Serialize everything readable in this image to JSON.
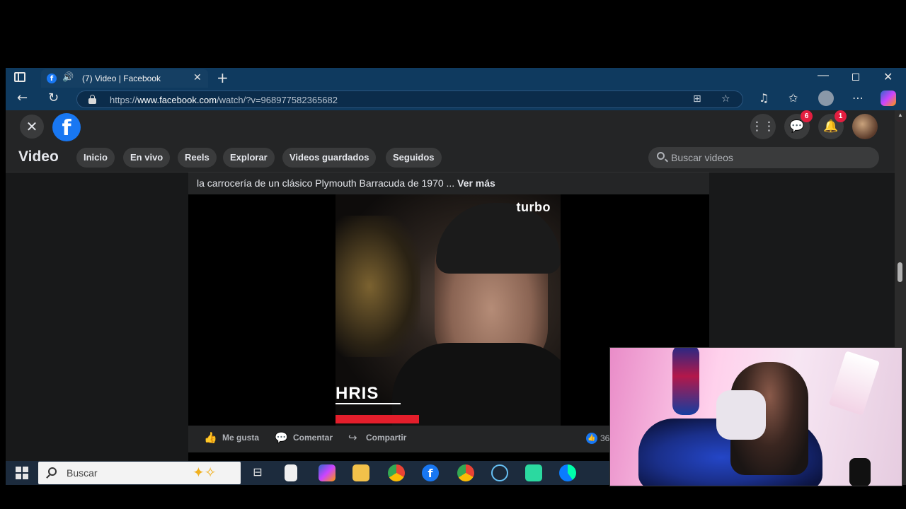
{
  "browser": {
    "tab_title": "(7) Video | Facebook",
    "url_prefix": "https://",
    "url_host": "www.facebook.com",
    "url_path": "/watch/?v=968977582365682"
  },
  "facebook": {
    "section_title": "Video",
    "nav_pills": [
      "Inicio",
      "En vivo",
      "Reels",
      "Explorar",
      "Videos guardados",
      "Seguidos"
    ],
    "search_placeholder": "Buscar videos",
    "messenger_badge": "6",
    "notifications_badge": "1",
    "caption": "la carrocería de un clásico Plymouth Barracuda de 1970 ...",
    "caption_more": "Ver más",
    "video_brand": "turbo",
    "video_lower_third": "HRIS",
    "actions": {
      "like": "Me gusta",
      "comment": "Comentar",
      "share": "Compartir"
    },
    "reaction_count": "36"
  },
  "taskbar": {
    "search_placeholder": "Buscar"
  },
  "colors": {
    "facebook_blue": "#1877f2",
    "badge_red": "#e41e3f",
    "titlebar": "#0f3a5f"
  }
}
